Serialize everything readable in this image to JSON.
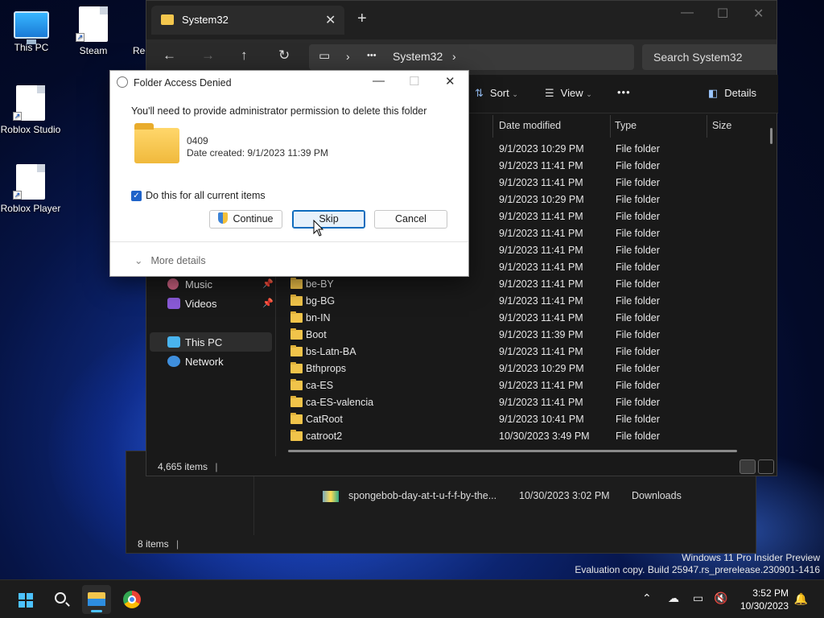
{
  "desktop": {
    "icons": [
      {
        "label": "This PC"
      },
      {
        "label": "Steam"
      },
      {
        "label": "Rec"
      },
      {
        "label": "Roblox Studio"
      },
      {
        "label": "Roblox Player"
      }
    ]
  },
  "background_explorer": {
    "file_name": "spongebob-day-at-t-u-f-f-by-the...",
    "file_date": "10/30/2023 3:02 PM",
    "file_location": "Downloads",
    "status": "8 items"
  },
  "explorer": {
    "tab_title": "System32",
    "address": {
      "segment": "System32",
      "ellipsis": "•••"
    },
    "search_placeholder": "Search System32",
    "commands": {
      "sort": "Sort",
      "view": "View",
      "more": "•••",
      "details": "Details"
    },
    "columns": {
      "date": "Date modified",
      "type": "Type",
      "size": "Size"
    },
    "sidebar": [
      {
        "label": "Music"
      },
      {
        "label": "Videos"
      },
      {
        "label": "This PC"
      },
      {
        "label": "Network"
      }
    ],
    "rows": [
      {
        "name": "",
        "date": "9/1/2023 10:29 PM",
        "type": "File folder"
      },
      {
        "name": "",
        "date": "9/1/2023 11:41 PM",
        "type": "File folder"
      },
      {
        "name": "",
        "date": "9/1/2023 11:41 PM",
        "type": "File folder"
      },
      {
        "name": "",
        "date": "9/1/2023 10:29 PM",
        "type": "File folder"
      },
      {
        "name": "",
        "date": "9/1/2023 11:41 PM",
        "type": "File folder"
      },
      {
        "name": "",
        "date": "9/1/2023 11:41 PM",
        "type": "File folder"
      },
      {
        "name": "",
        "date": "9/1/2023 11:41 PM",
        "type": "File folder"
      },
      {
        "name": "",
        "date": "9/1/2023 11:41 PM",
        "type": "File folder"
      },
      {
        "name": "be-BY",
        "date": "9/1/2023 11:41 PM",
        "type": "File folder"
      },
      {
        "name": "bg-BG",
        "date": "9/1/2023 11:41 PM",
        "type": "File folder"
      },
      {
        "name": "bn-IN",
        "date": "9/1/2023 11:41 PM",
        "type": "File folder"
      },
      {
        "name": "Boot",
        "date": "9/1/2023 11:39 PM",
        "type": "File folder"
      },
      {
        "name": "bs-Latn-BA",
        "date": "9/1/2023 11:41 PM",
        "type": "File folder"
      },
      {
        "name": "Bthprops",
        "date": "9/1/2023 10:29 PM",
        "type": "File folder"
      },
      {
        "name": "ca-ES",
        "date": "9/1/2023 11:41 PM",
        "type": "File folder"
      },
      {
        "name": "ca-ES-valencia",
        "date": "9/1/2023 11:41 PM",
        "type": "File folder"
      },
      {
        "name": "CatRoot",
        "date": "9/1/2023 10:41 PM",
        "type": "File folder"
      },
      {
        "name": "catroot2",
        "date": "10/30/2023 3:49 PM",
        "type": "File folder"
      }
    ],
    "status": "4,665 items"
  },
  "dialog": {
    "title": "Folder Access Denied",
    "message": "You'll need to provide administrator permission to delete this folder",
    "folder_name": "0409",
    "date_created": "Date created: 9/1/2023 11:39 PM",
    "checkbox_label": "Do this for all current items",
    "checkbox_checked": true,
    "buttons": {
      "continue": "Continue",
      "skip": "Skip",
      "cancel": "Cancel"
    },
    "more_details": "More details"
  },
  "watermark": {
    "line1": "Windows 11 Pro Insider Preview",
    "line2": "Evaluation copy. Build 25947.rs_prerelease.230901-1416"
  },
  "taskbar": {
    "time": "3:52 PM",
    "date": "10/30/2023"
  }
}
